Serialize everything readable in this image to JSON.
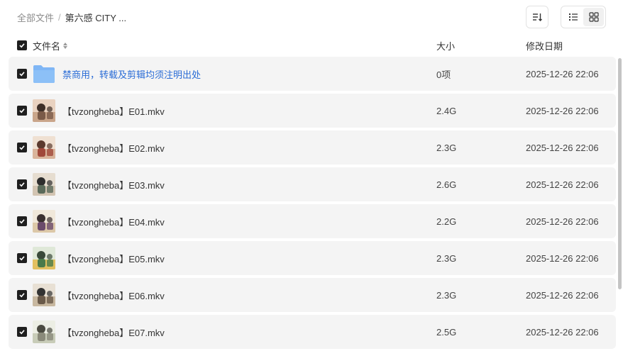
{
  "breadcrumb": {
    "root": "全部文件",
    "separator": "/",
    "current": "第六感 CITY ..."
  },
  "toolbar": {
    "sort_icon": "sort-list-icon",
    "list_view_icon": "list-view-icon",
    "grid_view_icon": "grid-view-icon",
    "active_view": "list"
  },
  "header": {
    "name": "文件名",
    "size": "大小",
    "modified": "修改日期"
  },
  "files": [
    {
      "name": "禁商用，转载及剪辑均须注明出处",
      "size": "0项",
      "date": "2025-12-26 22:06",
      "type": "folder"
    },
    {
      "name": "【tvzongheba】E01.mkv",
      "size": "2.4G",
      "date": "2025-12-26 22:06",
      "type": "video"
    },
    {
      "name": "【tvzongheba】E02.mkv",
      "size": "2.3G",
      "date": "2025-12-26 22:06",
      "type": "video"
    },
    {
      "name": "【tvzongheba】E03.mkv",
      "size": "2.6G",
      "date": "2025-12-26 22:06",
      "type": "video"
    },
    {
      "name": "【tvzongheba】E04.mkv",
      "size": "2.2G",
      "date": "2025-12-26 22:06",
      "type": "video"
    },
    {
      "name": "【tvzongheba】E05.mkv",
      "size": "2.3G",
      "date": "2025-12-26 22:06",
      "type": "video"
    },
    {
      "name": "【tvzongheba】E06.mkv",
      "size": "2.3G",
      "date": "2025-12-26 22:06",
      "type": "video"
    },
    {
      "name": "【tvzongheba】E07.mkv",
      "size": "2.5G",
      "date": "2025-12-26 22:06",
      "type": "video"
    }
  ],
  "colors": {
    "checkbox": "#1f1f1f",
    "folder_link": "#2a6cd6",
    "folder_icon": "#7fb6f5",
    "row_bg": "#f4f4f4"
  }
}
